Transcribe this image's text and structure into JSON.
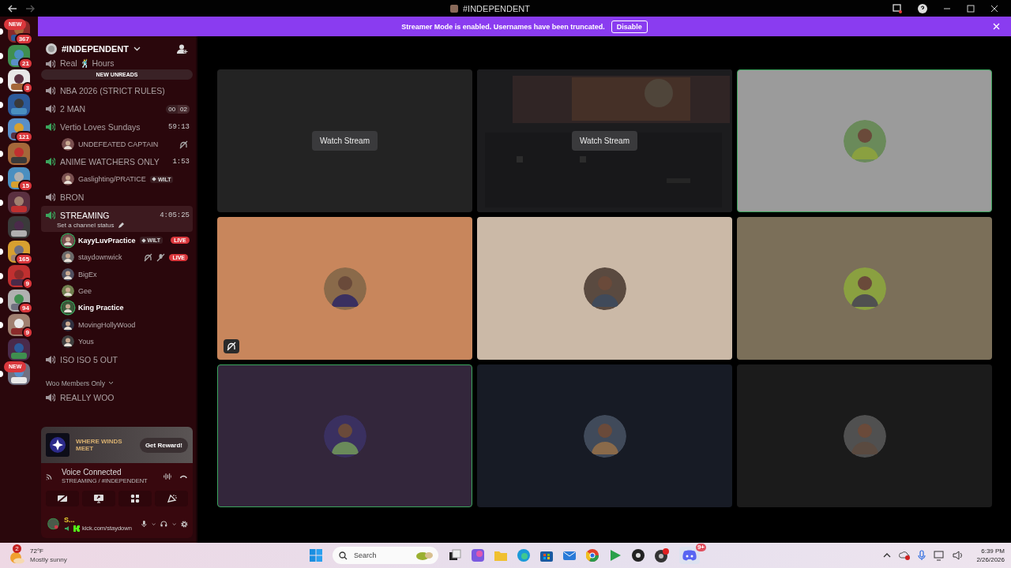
{
  "window": {
    "title": "#INDEPENDENT"
  },
  "banner": {
    "text": "Streamer Mode is enabled. Usernames have been truncated.",
    "button": "Disable"
  },
  "servers": [
    {
      "badge": "367",
      "unread": true,
      "new_pill": "NEW"
    },
    {
      "badge": "21",
      "unread": true
    },
    {
      "badge": "3",
      "unread": true
    },
    {
      "unread": true
    },
    {
      "badge": "121",
      "unread": true
    },
    {
      "unread": true
    },
    {
      "badge": "15",
      "unread": true
    },
    {
      "unread": true
    },
    {
      "unread": false
    },
    {
      "badge": "165",
      "unread": true
    },
    {
      "badge": "9",
      "unread": true
    },
    {
      "badge": "94",
      "unread": true
    },
    {
      "badge": "9",
      "unread": true
    },
    {
      "unread": false
    },
    {
      "unread": true,
      "new_pill": "NEW"
    }
  ],
  "server": {
    "name": "#INDEPENDENT",
    "new_unreads": "NEW UNREADS"
  },
  "channels": [
    {
      "kind": "voice",
      "name": "Real 🕺 Hours",
      "active": false,
      "selected": false
    },
    {
      "kind": "voice",
      "name": "NBA 2026 (STRICT RULES)",
      "active": false,
      "selected": false
    },
    {
      "kind": "voice",
      "name": "2 MAN",
      "active": false,
      "selected": false,
      "limit": [
        "00",
        "02"
      ]
    },
    {
      "kind": "voice",
      "name": "Vertio Loves Sundays",
      "active": true,
      "selected": false,
      "time": "59:13",
      "members": [
        {
          "name": "UNDEFEATED CAPTAIN",
          "speaking": false,
          "deafened": true,
          "muted": false
        }
      ]
    },
    {
      "kind": "voice",
      "name": "ANIME WATCHERS ONLY",
      "active": true,
      "selected": false,
      "time": "1:53",
      "members": [
        {
          "name": "Gaslighting/PRATICE",
          "speaking": false,
          "deafened": false,
          "muted": false,
          "tag": "WILT"
        }
      ]
    },
    {
      "kind": "voice",
      "name": "BRON",
      "active": false,
      "selected": false
    },
    {
      "kind": "voice",
      "name": "STREAMING",
      "active": true,
      "selected": true,
      "time": "4:05:25",
      "status": "Set a channel status",
      "members": [
        {
          "name": "KayyLuvPractice",
          "speaking": true,
          "deafened": false,
          "muted": false,
          "tag": "WILT",
          "live": "LIVE"
        },
        {
          "name": "staydownwick",
          "speaking": false,
          "deafened": true,
          "muted": true,
          "live": "LIVE"
        },
        {
          "name": "BigEx",
          "speaking": false,
          "deafened": false,
          "muted": false
        },
        {
          "name": "Gee",
          "speaking": false,
          "deafened": false,
          "muted": false
        },
        {
          "name": "King Practice",
          "speaking": true,
          "deafened": false,
          "muted": false
        },
        {
          "name": "MovingHollyWood",
          "speaking": false,
          "deafened": false,
          "muted": false
        },
        {
          "name": "Yous",
          "speaking": false,
          "deafened": false,
          "muted": false
        }
      ]
    },
    {
      "kind": "voice",
      "name": "ISO ISO 5 OUT",
      "active": false,
      "selected": false
    },
    {
      "kind": "category",
      "name": "Woo Members Only"
    },
    {
      "kind": "voice",
      "name": "REALLY WOO",
      "active": false,
      "selected": false
    }
  ],
  "promo": {
    "logo_text": "WHERE WINDS MEET",
    "button": "Get Reward!"
  },
  "voice": {
    "status": "Voice Connected",
    "channel": "STREAMING / #INDEPENDENT"
  },
  "user": {
    "name": "S...",
    "activity": "kick.com/staydown"
  },
  "tiles": [
    {
      "kind": "stream",
      "color": "#232323",
      "button": "Watch Stream",
      "speaking": false,
      "deafened": false
    },
    {
      "kind": "stream_preview",
      "color": "#2a2a2c",
      "button": "Watch Stream",
      "speaking": false,
      "deafened": false
    },
    {
      "kind": "avatar",
      "color": "#9b9b9b",
      "speaking": true,
      "deafened": false
    },
    {
      "kind": "avatar",
      "color": "#c8865c",
      "speaking": false,
      "deafened": true
    },
    {
      "kind": "avatar",
      "color": "#cbb9a7",
      "speaking": false,
      "deafened": false
    },
    {
      "kind": "avatar",
      "color": "#7b6f59",
      "speaking": false,
      "deafened": false
    },
    {
      "kind": "avatar",
      "color": "#33263b",
      "speaking": true,
      "deafened": false
    },
    {
      "kind": "avatar",
      "color": "#171b25",
      "speaking": false,
      "deafened": false
    },
    {
      "kind": "avatar",
      "color": "#1b1b1b",
      "speaking": false,
      "deafened": false
    }
  ],
  "taskbar": {
    "weather_badge": "2",
    "temperature": "72°F",
    "weather": "Mostly sunny",
    "search": "Search",
    "discord_badge": "9+",
    "time": "6:39 PM",
    "date": "2/26/2026"
  }
}
